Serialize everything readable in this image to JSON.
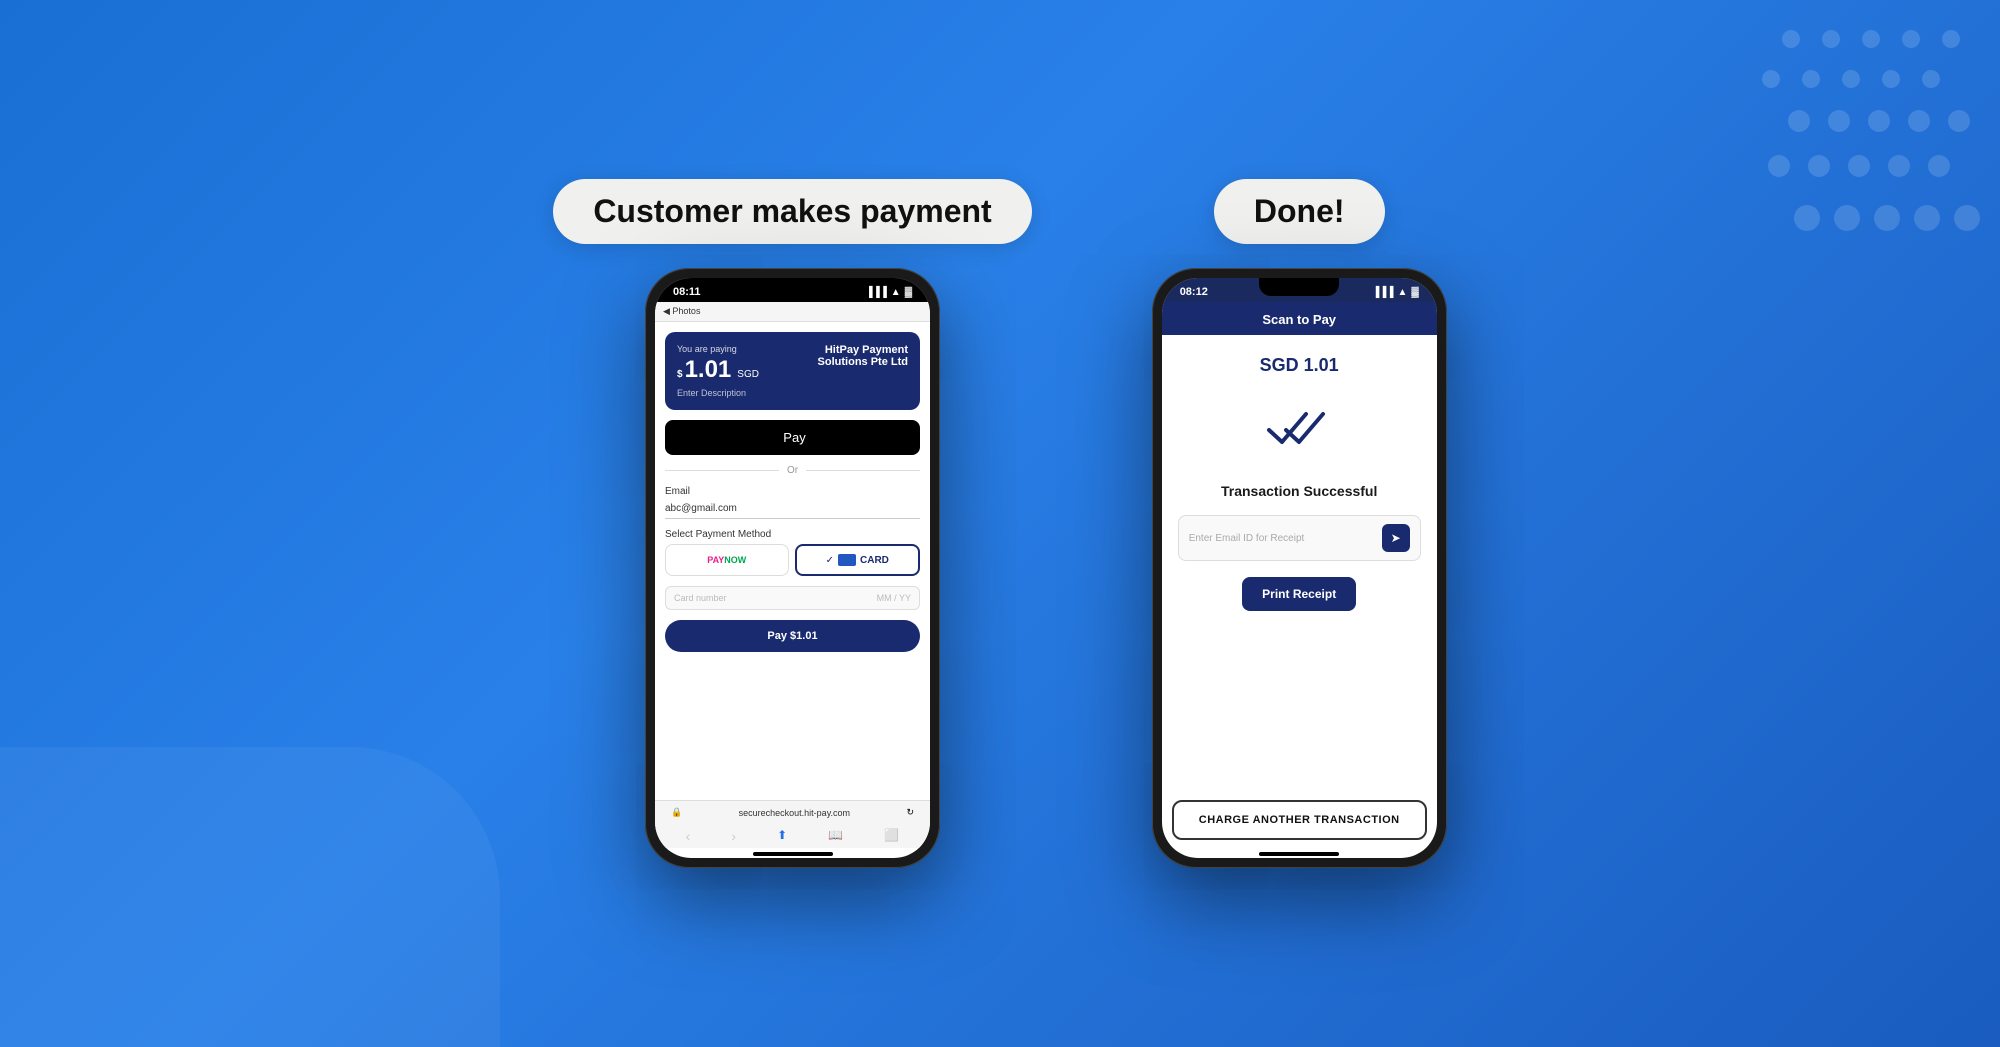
{
  "background": {
    "color": "#2271e8"
  },
  "panel_left": {
    "label": "Customer makes payment",
    "phone": {
      "status_time": "08:11",
      "back_label": "◀ Photos",
      "payment_header": {
        "you_are_paying": "You are paying",
        "amount_symbol": "$",
        "amount": "1.01",
        "currency": "SGD",
        "merchant_line1": "HitPay Payment",
        "merchant_line2": "Solutions Pte Ltd",
        "description_placeholder": "Enter Description"
      },
      "apple_pay_label": " Pay",
      "or_label": "Or",
      "email_label": "Email",
      "email_value": "abc@gmail.com",
      "payment_method_label": "Select Payment Method",
      "pay_now_label": "PAY NOW",
      "card_label": "CARD",
      "card_number_placeholder": "Card number",
      "card_expiry": "MM / YY",
      "pay_btn_label": "Pay $1.01",
      "browser_url": "securecheckout.hit-pay.com"
    }
  },
  "panel_right": {
    "label": "Done!",
    "phone": {
      "status_time": "08:12",
      "scan_to_pay_label": "Scan to Pay",
      "amount": "SGD 1.01",
      "transaction_success": "Transaction Successful",
      "email_placeholder": "Enter Email ID for Receipt",
      "print_receipt_label": "Print Receipt",
      "charge_another_label": "CHARGE ANOTHER TRANSACTION"
    }
  }
}
